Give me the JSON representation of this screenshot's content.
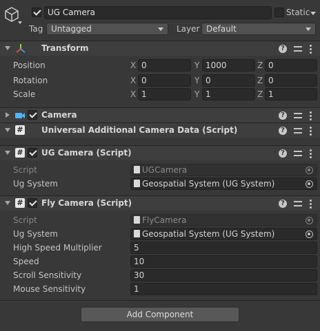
{
  "object": {
    "name": "UG Camera",
    "active": true,
    "static_label": "Static",
    "static": false,
    "tag_label": "Tag",
    "tag_value": "Untagged",
    "layer_label": "Layer",
    "layer_value": "Default"
  },
  "transform": {
    "title": "Transform",
    "rows": [
      {
        "label": "Position",
        "x": "0",
        "y": "1000",
        "z": "0"
      },
      {
        "label": "Rotation",
        "x": "0",
        "y": "0",
        "z": "0"
      },
      {
        "label": "Scale",
        "x": "1",
        "y": "1",
        "z": "1"
      }
    ],
    "axis": {
      "x": "X",
      "y": "Y",
      "z": "Z"
    }
  },
  "camera": {
    "title": "Camera",
    "enabled": true
  },
  "uacd": {
    "title": "Universal Additional Camera Data (Script)"
  },
  "ug_camera": {
    "title": "UG Camera (Script)",
    "enabled": true,
    "script_label": "Script",
    "script_value": "UGCamera",
    "ug_system_label": "Ug System",
    "ug_system_value": "Geospatial System (UG System)"
  },
  "fly_camera": {
    "title": "Fly Camera (Script)",
    "enabled": true,
    "script_label": "Script",
    "script_value": "FlyCamera",
    "ug_system_label": "Ug System",
    "ug_system_value": "Geospatial System (UG System)",
    "fields": [
      {
        "label": "High Speed Multiplier",
        "value": "5"
      },
      {
        "label": "Speed",
        "value": "10"
      },
      {
        "label": "Scroll Sensitivity",
        "value": "30"
      },
      {
        "label": "Mouse Sensitivity",
        "value": "1"
      }
    ]
  },
  "add_component_label": "Add Component",
  "icons": {
    "object": "cube-icon",
    "transform": "transform-axes-icon",
    "camera": "camera-icon",
    "script": "script-hash-icon",
    "help": "help-icon",
    "presets": "presets-icon",
    "more": "more-vertical-icon",
    "target": "object-picker-icon"
  },
  "colors": {
    "background": "#383838",
    "header": "#3e3e3e",
    "field": "#2a2a2a",
    "camera_icon": "#4fb3ff",
    "axis_red": "#e84b3c",
    "axis_green": "#8fd14f",
    "axis_blue": "#4a8fe8"
  }
}
